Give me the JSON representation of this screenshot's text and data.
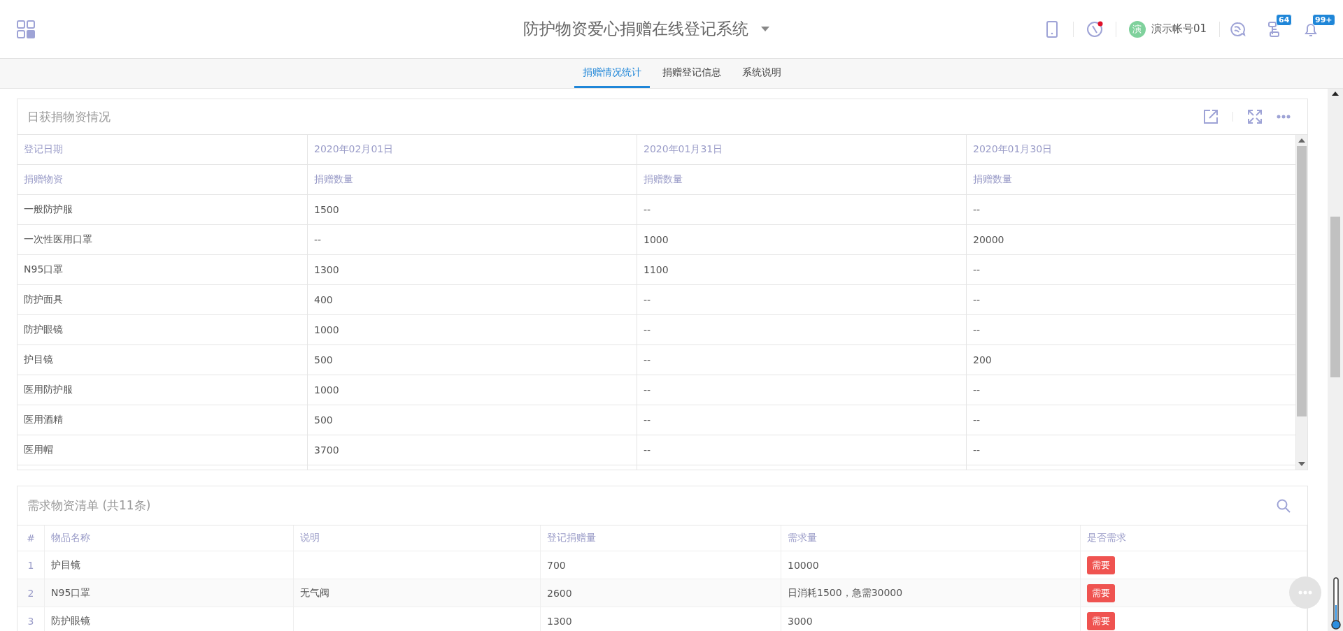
{
  "header": {
    "title": "防护物资爱心捐赠在线登记系统",
    "tools": [
      {
        "kind": "phone"
      },
      {
        "kind": "compass",
        "alert": true
      }
    ],
    "user": {
      "avatar_text": "演",
      "name": "演示帐号01"
    },
    "notifications": [
      {
        "kind": "chat"
      },
      {
        "kind": "org",
        "badge": "64"
      },
      {
        "kind": "bell",
        "badge": "99+"
      }
    ]
  },
  "tabs": [
    {
      "label": "捐赠情况统计",
      "selected": true
    },
    {
      "label": "捐赠登记信息",
      "selected": false
    },
    {
      "label": "系统说明",
      "selected": false
    }
  ],
  "daily_card": {
    "title": "日获捐物资情况",
    "header_rows": [
      [
        "登记日期",
        "2020年02月01日",
        "2020年01月31日",
        "2020年01月30日"
      ],
      [
        "捐赠物资",
        "捐赠数量",
        "捐赠数量",
        "捐赠数量"
      ]
    ],
    "rows": [
      [
        "一般防护服",
        "1500",
        "--",
        "--"
      ],
      [
        "一次性医用口罩",
        "--",
        "1000",
        "20000"
      ],
      [
        "N95口罩",
        "1300",
        "1100",
        "--"
      ],
      [
        "防护面具",
        "400",
        "--",
        "--"
      ],
      [
        "防护眼镜",
        "1000",
        "--",
        "--"
      ],
      [
        "护目镜",
        "500",
        "--",
        "200"
      ],
      [
        "医用防护服",
        "1000",
        "--",
        "--"
      ],
      [
        "医用酒精",
        "500",
        "--",
        "--"
      ],
      [
        "医用帽",
        "3700",
        "--",
        "--"
      ]
    ]
  },
  "demand_card": {
    "title": "需求物资清单 (共11条)",
    "columns": [
      "#",
      "物品名称",
      "说明",
      "登记捐赠量",
      "需求量",
      "是否需求"
    ],
    "rows": [
      {
        "index": "1",
        "name": "护目镜",
        "note": "",
        "registered": "700",
        "demand": "10000",
        "need": "需要"
      },
      {
        "index": "2",
        "name": "N95口罩",
        "note": "无气阀",
        "registered": "2600",
        "demand": "日消耗1500，急需30000",
        "need": "需要"
      },
      {
        "index": "3",
        "name": "防护眼镜",
        "note": "",
        "registered": "1300",
        "demand": "3000",
        "need": "需要"
      }
    ]
  }
}
